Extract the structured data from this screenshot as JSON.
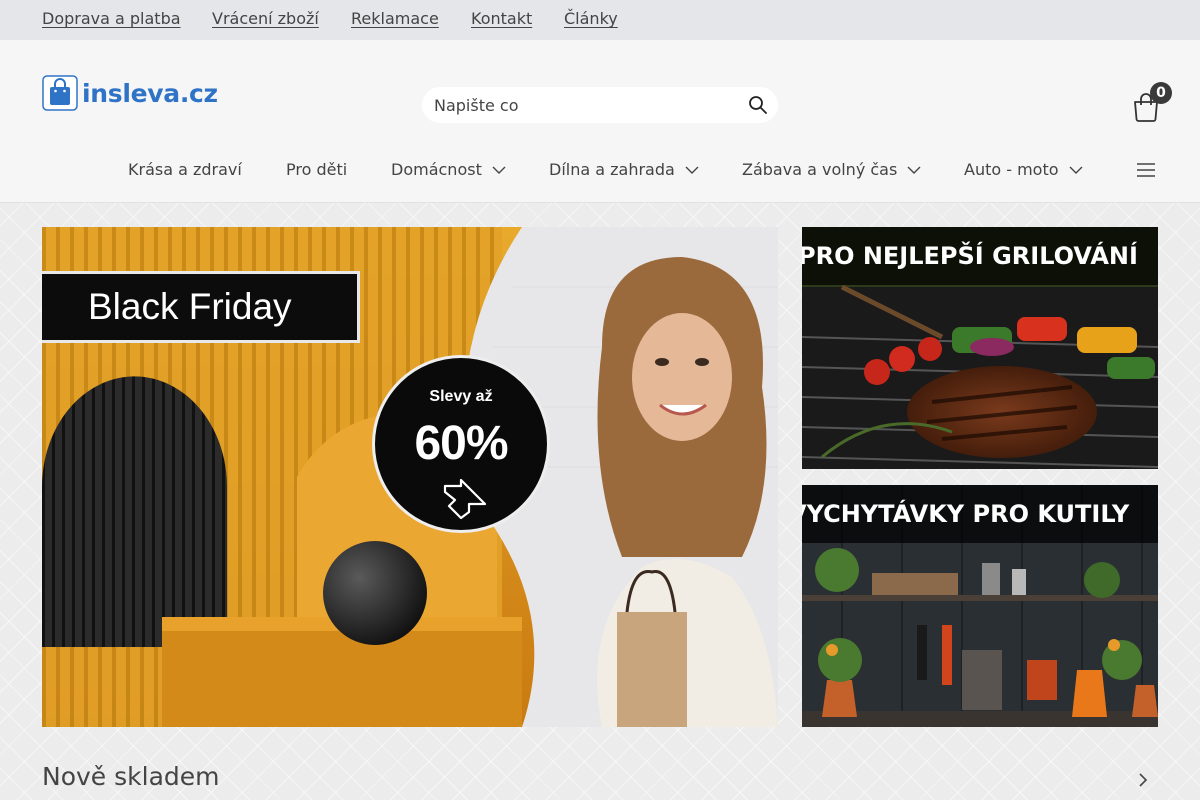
{
  "topbar": {
    "links": [
      "Doprava a platba",
      "Vrácení zboží",
      "Reklamace",
      "Kontakt",
      "Články"
    ]
  },
  "header": {
    "logo_text": "insleva.cz",
    "search_placeholder": "Napište co",
    "cart_count": "0"
  },
  "nav": {
    "items": [
      "Krása a zdraví",
      "Pro děti",
      "Domácnost",
      "Dílna a zahrada",
      "Zábava a volný čas",
      "Auto - moto"
    ]
  },
  "hero": {
    "title": "Black Friday",
    "sale_small": "Slevy až",
    "sale_big": "60%"
  },
  "side_banners": [
    {
      "title": "PRO NEJLEPŠÍ GRILOVÁNÍ"
    },
    {
      "title": "VYCHYTÁVKY PRO KUTILY"
    }
  ],
  "section": {
    "title": "Nově skladem"
  },
  "colors": {
    "brand_blue": "#2f73c7",
    "hero_orange": "#e0a024",
    "badge_dark": "#3a3a3a"
  },
  "icons": [
    "search-icon",
    "cart-icon",
    "chevron-down-icon",
    "menu-icon",
    "chevron-right-icon",
    "arrow-down-right-icon"
  ]
}
